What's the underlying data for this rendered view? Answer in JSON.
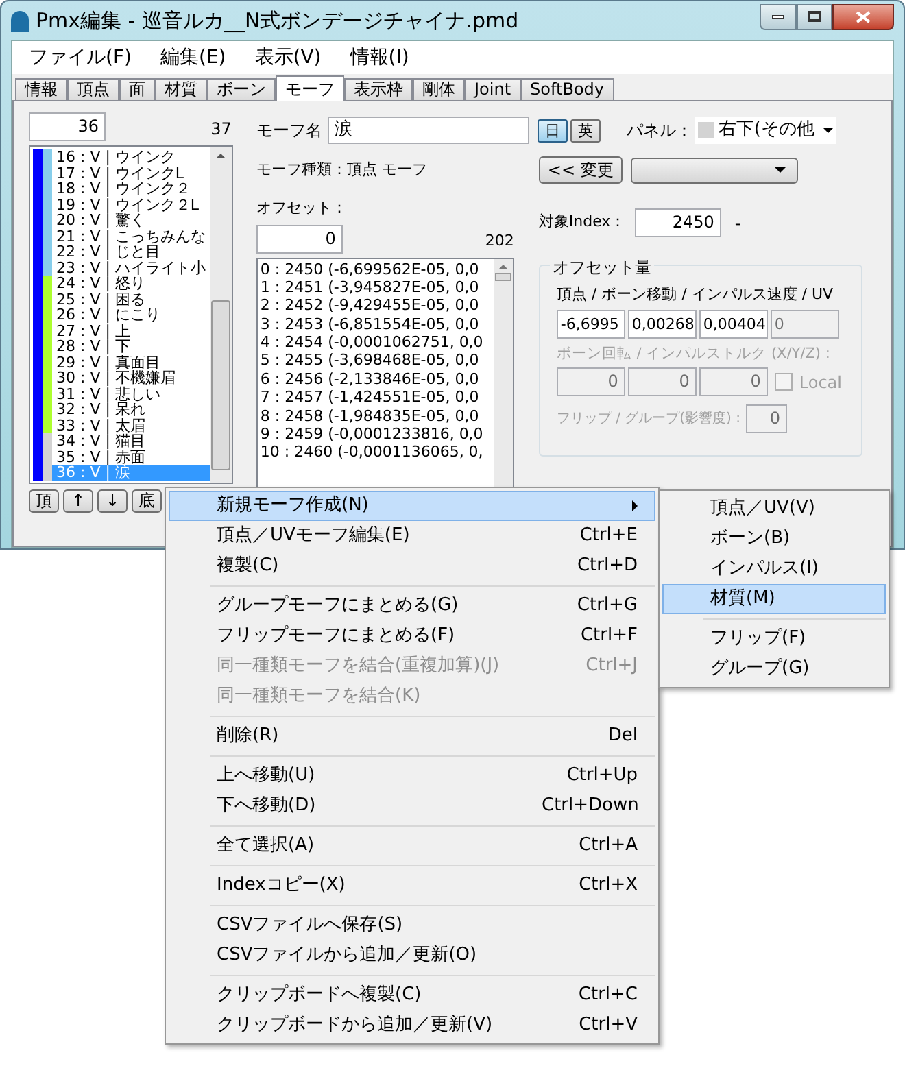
{
  "window": {
    "title": "Pmx編集 - 巡音ルカ__N式ボンデージチャイナ.pmd"
  },
  "menubar": [
    "ファイル(F)",
    "編集(E)",
    "表示(V)",
    "情報(I)"
  ],
  "tabs": [
    {
      "label": "情報",
      "selected": false
    },
    {
      "label": "頂点",
      "selected": false
    },
    {
      "label": "面",
      "selected": false
    },
    {
      "label": "材質",
      "selected": false
    },
    {
      "label": "ボーン",
      "selected": false
    },
    {
      "label": "モーフ",
      "selected": true
    },
    {
      "label": "表示枠",
      "selected": false
    },
    {
      "label": "剛体",
      "selected": false
    },
    {
      "label": "Joint",
      "selected": false
    },
    {
      "label": "SoftBody",
      "selected": false
    }
  ],
  "morph_list": {
    "index_value": "36",
    "count": "37",
    "items": [
      {
        "text": "16 : V | ウインク",
        "color": "#87ceeb",
        "selected": false
      },
      {
        "text": "17 : V | ウインクL",
        "color": "#87ceeb",
        "selected": false
      },
      {
        "text": "18 : V | ウインク２",
        "color": "#87ceeb",
        "selected": false
      },
      {
        "text": "19 : V | ウインク２L",
        "color": "#87ceeb",
        "selected": false
      },
      {
        "text": "20 : V | 驚く",
        "color": "#87ceeb",
        "selected": false
      },
      {
        "text": "21 : V | こっちみんな",
        "color": "#87ceeb",
        "selected": false
      },
      {
        "text": "22 : V | じと目",
        "color": "#87ceeb",
        "selected": false
      },
      {
        "text": "23 : V | ハイライト小",
        "color": "#87ceeb",
        "selected": false
      },
      {
        "text": "24 : V | 怒り",
        "color": "#adff2f",
        "selected": false
      },
      {
        "text": "25 : V | 困る",
        "color": "#adff2f",
        "selected": false
      },
      {
        "text": "26 : V | にこり",
        "color": "#adff2f",
        "selected": false
      },
      {
        "text": "27 : V | 上",
        "color": "#adff2f",
        "selected": false
      },
      {
        "text": "28 : V | 下",
        "color": "#adff2f",
        "selected": false
      },
      {
        "text": "29 : V | 真面目",
        "color": "#adff2f",
        "selected": false
      },
      {
        "text": "30 : V | 不機嫌眉",
        "color": "#adff2f",
        "selected": false
      },
      {
        "text": "31 : V | 悲しい",
        "color": "#adff2f",
        "selected": false
      },
      {
        "text": "32 : V | 呆れ",
        "color": "#adff2f",
        "selected": false
      },
      {
        "text": "33 : V | 太眉",
        "color": "#adff2f",
        "selected": false
      },
      {
        "text": "34 : V | 猫目",
        "color": "#d3d3d3",
        "selected": false
      },
      {
        "text": "35 : V | 赤面",
        "color": "#d3d3d3",
        "selected": false
      },
      {
        "text": "36 : V | 涙",
        "color": "#d3d3d3",
        "selected": true
      }
    ],
    "nav_buttons": [
      "頂",
      "↑",
      "↓",
      "底"
    ]
  },
  "morph_name": {
    "label": "モーフ名",
    "value": "涙",
    "languages": [
      {
        "label": "日",
        "selected": true
      },
      {
        "label": "英",
        "selected": false
      }
    ]
  },
  "panel": {
    "label": "パネル：",
    "value": "右下(その他"
  },
  "morph_type": "モーフ種類：頂点 モーフ",
  "change_button": "<< 変更",
  "offsets": {
    "label": "オフセット：",
    "value": "0",
    "count": "202",
    "rows": [
      "0 : 2450 (-6,699562E-05, 0,0",
      "1 : 2451 (-3,945827E-05, 0,0",
      "2 : 2452 (-9,429455E-05, 0,0",
      "3 : 2453 (-6,851554E-05, 0,0",
      "4 : 2454 (-0,0001062751, 0,0",
      "5 : 2455 (-3,698468E-05, 0,0",
      "6 : 2456 (-2,133846E-05, 0,0",
      "7 : 2457 (-1,424551E-05, 0,0",
      "8 : 2458 (-1,984835E-05, 0,0",
      "9 : 2459 (-0,0001233816, 0,0",
      "10 : 2460 (-0,0001136065, 0,"
    ]
  },
  "target_index": {
    "label": "対象Index：",
    "value": "2450",
    "suffix": "-"
  },
  "offset_amount": {
    "title": "オフセット量",
    "move": {
      "label": "頂点 / ボーン移動 / インパルス速度 / UV",
      "fields": [
        {
          "value": "-6,6995",
          "disabled": false
        },
        {
          "value": "0,00268",
          "disabled": false
        },
        {
          "value": "0,00404",
          "disabled": false
        },
        {
          "value": "0",
          "disabled": true
        }
      ]
    },
    "rotation": {
      "label": "ボーン回転 / インパルストルク (X/Y/Z) :",
      "disabled": true,
      "fields": [
        "0",
        "0",
        "0"
      ],
      "local": {
        "label": "Local",
        "checked": false
      }
    },
    "weight": {
      "label": "フリップ / グループ(影響度) :",
      "value": "0"
    }
  },
  "context_menu": [
    {
      "kind": "item",
      "label": "新規モーフ作成(N)",
      "submenu": true,
      "selected": true,
      "disabled": false
    },
    {
      "kind": "item",
      "label": "頂点／UVモーフ編集(E)",
      "shortcut": "Ctrl+E",
      "selected": false,
      "disabled": false
    },
    {
      "kind": "item",
      "label": "複製(C)",
      "shortcut": "Ctrl+D",
      "selected": false,
      "disabled": false
    },
    {
      "kind": "separator"
    },
    {
      "kind": "item",
      "label": "グループモーフにまとめる(G)",
      "shortcut": "Ctrl+G",
      "selected": false,
      "disabled": false
    },
    {
      "kind": "item",
      "label": "フリップモーフにまとめる(F)",
      "shortcut": "Ctrl+F",
      "selected": false,
      "disabled": false
    },
    {
      "kind": "item",
      "label": "同一種類モーフを結合(重複加算)(J)",
      "shortcut": "Ctrl+J",
      "selected": false,
      "disabled": true
    },
    {
      "kind": "item",
      "label": "同一種類モーフを結合(K)",
      "selected": false,
      "disabled": true
    },
    {
      "kind": "separator"
    },
    {
      "kind": "item",
      "label": "削除(R)",
      "shortcut": "Del",
      "selected": false,
      "disabled": false
    },
    {
      "kind": "separator"
    },
    {
      "kind": "item",
      "label": "上へ移動(U)",
      "shortcut": "Ctrl+Up",
      "selected": false,
      "disabled": false
    },
    {
      "kind": "item",
      "label": "下へ移動(D)",
      "shortcut": "Ctrl+Down",
      "selected": false,
      "disabled": false
    },
    {
      "kind": "separator"
    },
    {
      "kind": "item",
      "label": "全て選択(A)",
      "shortcut": "Ctrl+A",
      "selected": false,
      "disabled": false
    },
    {
      "kind": "separator"
    },
    {
      "kind": "item",
      "label": "Indexコピー(X)",
      "shortcut": "Ctrl+X",
      "selected": false,
      "disabled": false
    },
    {
      "kind": "separator"
    },
    {
      "kind": "item",
      "label": "CSVファイルへ保存(S)",
      "selected": false,
      "disabled": false
    },
    {
      "kind": "item",
      "label": "CSVファイルから追加／更新(O)",
      "selected": false,
      "disabled": false
    },
    {
      "kind": "separator"
    },
    {
      "kind": "item",
      "label": "クリップボードへ複製(C)",
      "shortcut": "Ctrl+C",
      "selected": false,
      "disabled": false
    },
    {
      "kind": "item",
      "label": "クリップボードから追加／更新(V)",
      "shortcut": "Ctrl+V",
      "selected": false,
      "disabled": false
    }
  ],
  "submenu": [
    {
      "kind": "item",
      "label": "頂点／UV(V)",
      "selected": false
    },
    {
      "kind": "item",
      "label": "ボーン(B)",
      "selected": false
    },
    {
      "kind": "item",
      "label": "インパルス(I)",
      "selected": false
    },
    {
      "kind": "item",
      "label": "材質(M)",
      "selected": true
    },
    {
      "kind": "separator"
    },
    {
      "kind": "item",
      "label": "フリップ(F)",
      "selected": false
    },
    {
      "kind": "item",
      "label": "グループ(G)",
      "selected": false
    }
  ]
}
